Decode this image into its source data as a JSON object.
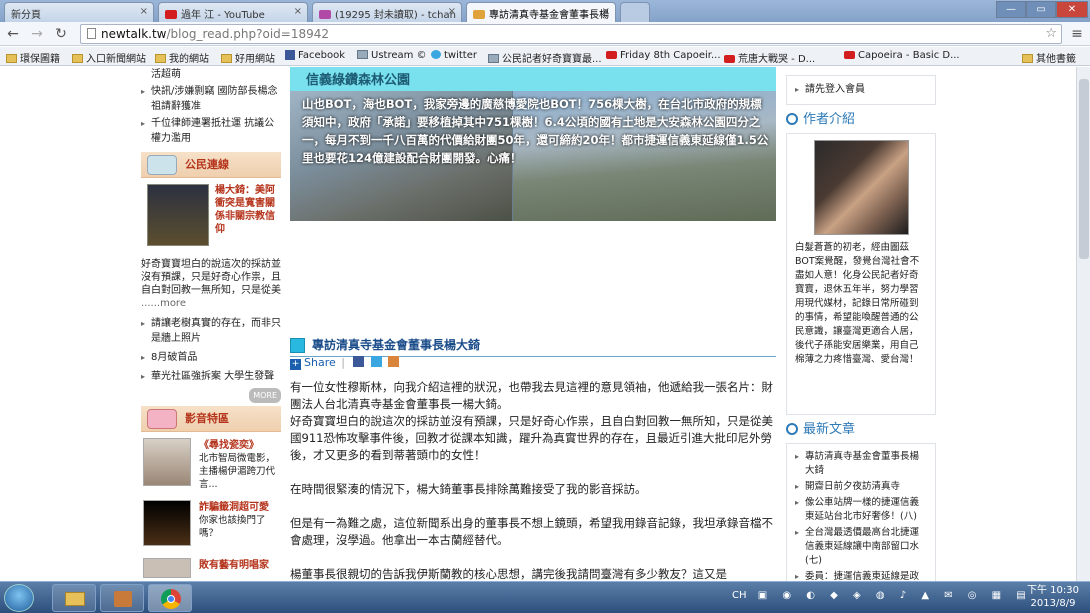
{
  "browser": {
    "tabs": [
      {
        "label": "新分頁"
      },
      {
        "label": "過年 江 - YouTube"
      },
      {
        "label": "(19295 封未讀取) - tchan"
      },
      {
        "label": "專訪清真寺基金會董事長楊"
      }
    ],
    "url_host": "newtalk.tw",
    "url_path": "/blog_read.php?oid=18942",
    "bookmarks": [
      {
        "label": "環保圖籍",
        "icon": "folder"
      },
      {
        "label": "入口新聞網站",
        "icon": "folder"
      },
      {
        "label": "我的網站",
        "icon": "folder"
      },
      {
        "label": "好用網站",
        "icon": "folder"
      },
      {
        "label": "Facebook",
        "icon": "facebook"
      },
      {
        "label": "Ustream ©",
        "icon": "ustream"
      },
      {
        "label": "twitter",
        "icon": "twitter"
      },
      {
        "label": "公民記者好奇寶寶最...",
        "icon": "ustream"
      },
      {
        "label": "Friday 8th Capoeir...",
        "icon": "youtube"
      },
      {
        "label": "荒唐大戰哭 - D...",
        "icon": "youtube"
      },
      {
        "label": "Capoeira - Basic D...",
        "icon": "youtube"
      },
      {
        "label": "其他書籤",
        "icon": "folder"
      }
    ]
  },
  "left": {
    "top_items": [
      "活超萌",
      "快訊/涉嫌剽竊 國防部長楊念祖請辭獲准",
      "千位律師連署抵社運 抗議公權力濫用"
    ],
    "section1_title": "公民連線",
    "feature_title": "楊大錡：美阿衝突是寬害關係非關宗教信仰",
    "feature_text": "好奇寶寶坦白的說這次的採訪並沒有預課，只是好奇心作祟，且自白對回教一無所知，只是從美",
    "feature_more": "......more",
    "items2": [
      "請讓老樹真實的存在，而非只是牆上照片",
      "8月破首品",
      "華光社區強拆案 大學生發聲"
    ],
    "more_label": "MORE",
    "section2_title": "影音特區",
    "video1_title": "《尋找瓷奕》",
    "video1_text": "北市智局微電影，主播楊伊湄跨刀代言...",
    "video2_title": "詐騙籤洞超可愛",
    "video2_text": "你家也該換門了嗎？",
    "video3_title": "敗有藝有明唱家"
  },
  "banner": {
    "caption": "信義綠鑽森林公園",
    "text": "山也BOT，海也BOT，我家旁邊的廣慈博愛院也BOT！756棵大樹，在台北市政府的規標須知中，政府「承諾」要移植掉其中751棵樹！6.4公頃的國有土地是大安森林公園四分之一，每月不到一千八百萬的代價給財團50年，還可締約20年！都市捷運信義東延線僅1.5公里也要花124億建設配合財團開發。心痛！"
  },
  "article": {
    "title": "專訪清真寺基金會董事長楊大錡",
    "share_label": "Share",
    "paragraphs": [
      "有一位女性穆斯林，向我介紹這裡的狀況，也帶我去見這裡的意見領袖，他遞給我一張名片：財團法人台北清真寺基金會董事長一楊大錡。\n好奇寶寶坦白的說這次的採訪並沒有預課，只是好奇心作祟，且自白對回教一無所知，只是從美國911恐怖攻擊事件後，回教才從課本知識，躍升為真實世界的存在，且最近引進大批印尼外勞後，才又更多的看到蒂著頭巾的女性！",
      "在時間很緊湊的情況下，楊大錡董事長排除萬難接受了我的影音採訪。",
      "但是有一為難之處，這位新聞系出身的董事長不想上鏡頭，希望我用錄音記錄，我坦承錄音檔不會處理，沒學過。他拿出一本古蘭經替代。",
      "楊董事長很親切的告訴我伊斯蘭教的核心思想，講完後我請問臺灣有多少教友？這又是"
    ]
  },
  "right": {
    "login_item": "請先登入會員",
    "author_head": "作者介紹",
    "author_bio": "白髮蒼蒼的初老，經由圖茲BOT案覺醒，發覺台灣社會不盡如人意！化身公民記者好奇寶寶，退休五年半，努力學習用現代媒材，記錄日常所碰到的事情，希望能喚醒普通的公民意識，讓臺灣更適合人居，後代子孫能安居樂業，用自己棉薄之力疼惜臺灣、愛台灣！",
    "latest_head": "最新文章",
    "latest": [
      "專訪清真寺基金會董事長楊大錡",
      "開齋日前夕夜訪清真寺",
      "像公車站牌一樣的捷運信義東延站台北市好奢侈！(八)",
      "全台灣最透價最高台北捷運信義東延線讓中南部留口水(七)",
      "委員：捷運信義東延線是政策考量後的根本不需要"
    ]
  },
  "taskbar": {
    "lang": "CH",
    "time": "下午 10:30",
    "date": "2013/8/9"
  }
}
